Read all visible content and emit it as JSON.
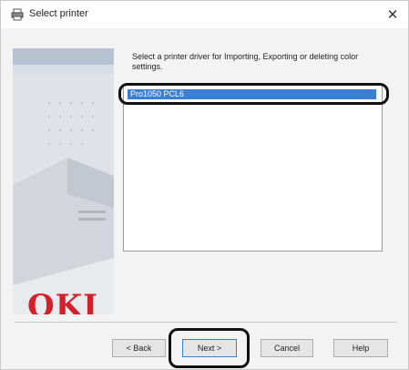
{
  "window": {
    "title": "Select printer",
    "close_glyph": "✕"
  },
  "branding": {
    "logo_text": "OKI",
    "logo_color": "#d3202a"
  },
  "main": {
    "instruction": "Select a printer driver for Importing, Exporting or deleting color settings.",
    "printers": [
      {
        "label": "Pro1050 PCL6",
        "selected": true
      }
    ]
  },
  "buttons": {
    "back": "< Back",
    "next": "Next >",
    "cancel": "Cancel",
    "help": "Help"
  },
  "colors": {
    "selection": "#3a7fd0",
    "highlight_ring": "#111111"
  }
}
